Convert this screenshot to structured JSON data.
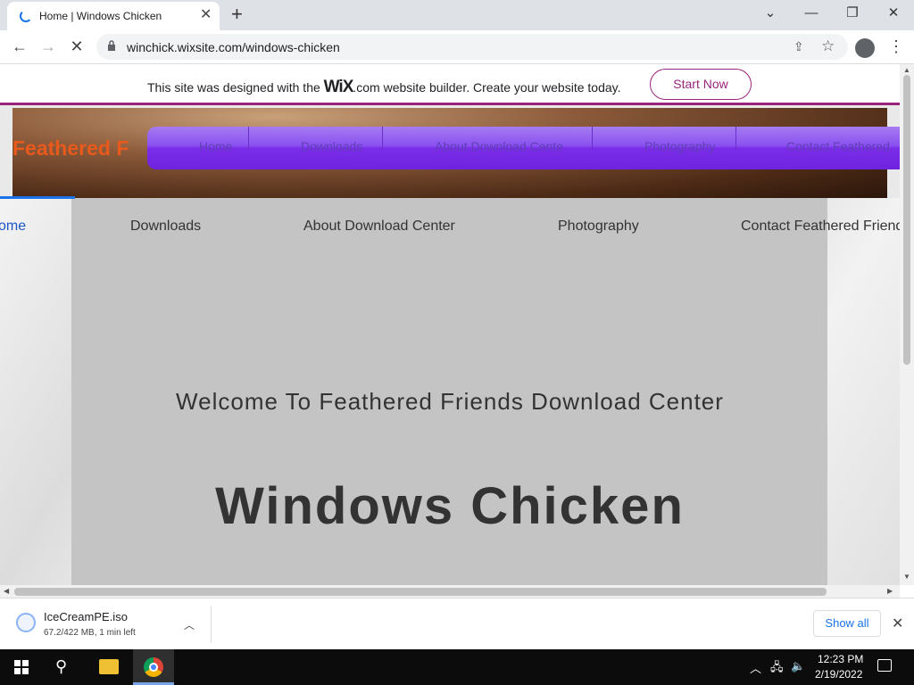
{
  "browser": {
    "tab_title": "Home | Windows Chicken",
    "url": "winchick.wixsite.com/windows-chicken",
    "new_tab": "+",
    "tab_close": "✕",
    "window": {
      "minimize": "—",
      "maximize": "❐",
      "close": "✕",
      "dropdown": "⌄"
    }
  },
  "wix_banner": {
    "text_before": "This site was designed with the ",
    "logo": "WiX",
    "text_after": ".com website builder. Create your website today.",
    "cta": "Start Now"
  },
  "site": {
    "title": "Feathered F",
    "purple_nav": [
      "Home",
      "Downloads",
      "About Download Cente",
      "Photography",
      "Contact Feathered"
    ],
    "nav": [
      "ome",
      "Downloads",
      "About Download Center",
      "Photography",
      "Contact Feathered Friend"
    ],
    "welcome": "Welcome To Feathered Friends Download Center",
    "main_title": "Windows Chicken"
  },
  "download": {
    "file_name": "IceCreamPE.iso",
    "status": "67.2/422 MB, 1 min left",
    "show_all": "Show all"
  },
  "taskbar": {
    "time": "12:23 PM",
    "date": "2/19/2022"
  },
  "colors": {
    "wix_accent": "#99247c",
    "site_title": "#e8591c",
    "purple_nav": "#7b2de8",
    "link_blue": "#1a57c8"
  }
}
